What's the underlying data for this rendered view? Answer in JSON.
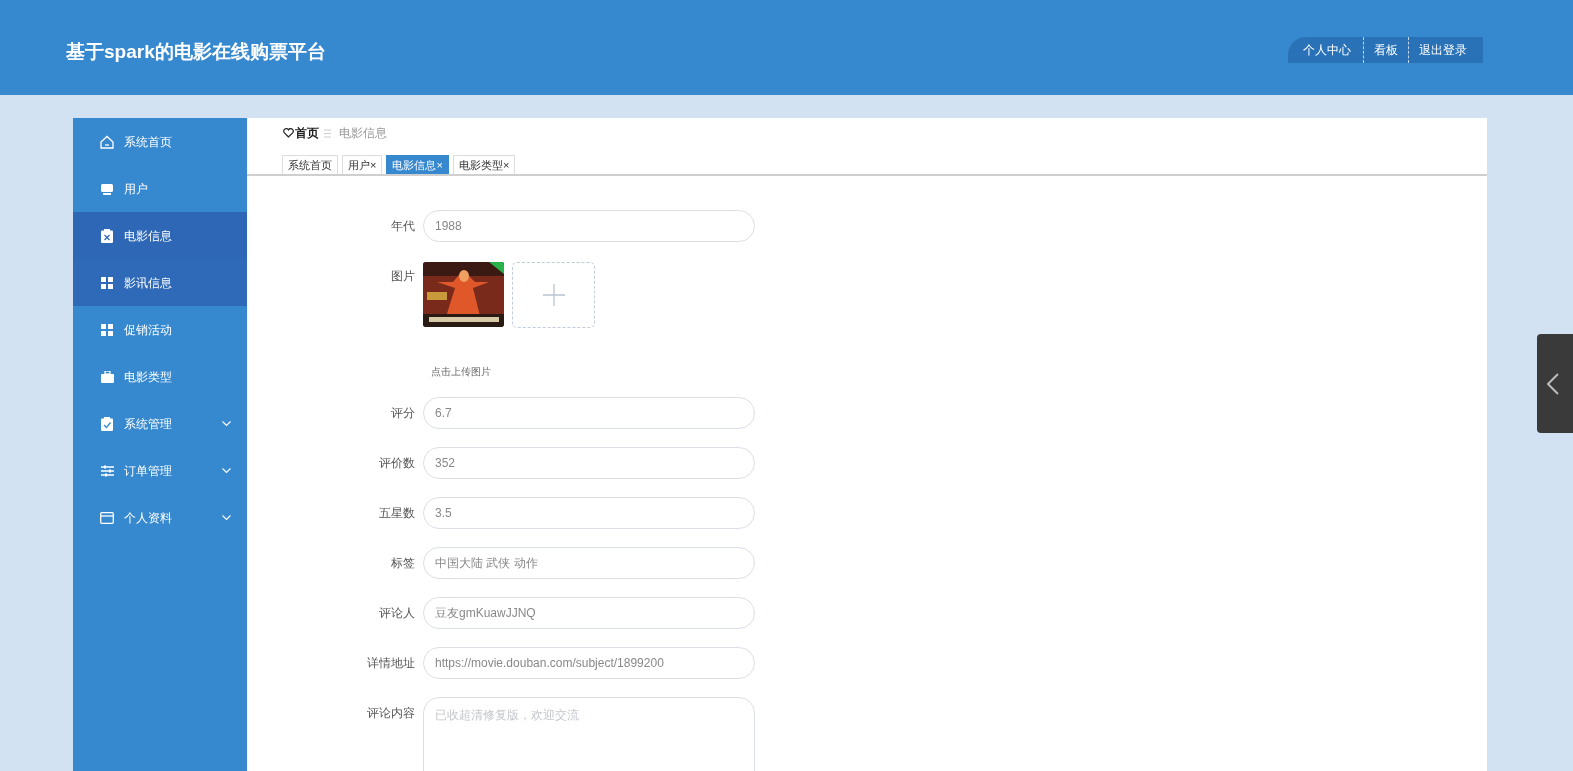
{
  "header": {
    "title": "基于spark的电影在线购票平台",
    "links": [
      "个人中心",
      "看板",
      "退出登录"
    ]
  },
  "sidebar": {
    "items": [
      {
        "label": "系统首页",
        "selected": false,
        "hovered": false,
        "expandable": false
      },
      {
        "label": "用户",
        "selected": false,
        "hovered": false,
        "expandable": false
      },
      {
        "label": "电影信息",
        "selected": true,
        "hovered": false,
        "expandable": false
      },
      {
        "label": "影讯信息",
        "selected": false,
        "hovered": true,
        "expandable": false
      },
      {
        "label": "促销活动",
        "selected": false,
        "hovered": false,
        "expandable": false
      },
      {
        "label": "电影类型",
        "selected": false,
        "hovered": false,
        "expandable": false
      },
      {
        "label": "系统管理",
        "selected": false,
        "hovered": false,
        "expandable": true
      },
      {
        "label": "订单管理",
        "selected": false,
        "hovered": false,
        "expandable": true
      },
      {
        "label": "个人资料",
        "selected": false,
        "hovered": false,
        "expandable": true
      }
    ]
  },
  "breadcrumb": {
    "home": "首页",
    "current": "电影信息"
  },
  "tabs": [
    {
      "label": "系统首页",
      "selected": false
    },
    {
      "label": "用户",
      "close": "×",
      "selected": false
    },
    {
      "label": "电影信息",
      "close": "×",
      "selected": true
    },
    {
      "label": "电影类型",
      "close": "×",
      "selected": false
    }
  ],
  "form": [
    {
      "kind": "input",
      "label": "年代",
      "value": "1988"
    },
    {
      "label": "图片",
      "hint": "点击上传图片"
    },
    {
      "kind": "input",
      "label": "评分",
      "value": "6.7"
    },
    {
      "kind": "input",
      "label": "评价数",
      "value": "352"
    },
    {
      "kind": "input",
      "label": "五星数",
      "value": "3.5"
    },
    {
      "kind": "input",
      "label": "标签",
      "value": "中国大陆 武侠 动作"
    },
    {
      "kind": "input",
      "label": "评论人",
      "value": "豆友gmKuawJJNQ"
    },
    {
      "kind": "input",
      "label": "详情地址",
      "value": "https://movie.douban.com/subject/1899200"
    },
    {
      "kind": "textarea",
      "label": "评论内容",
      "placeholder": "已收超清修复版，欢迎交流"
    }
  ]
}
